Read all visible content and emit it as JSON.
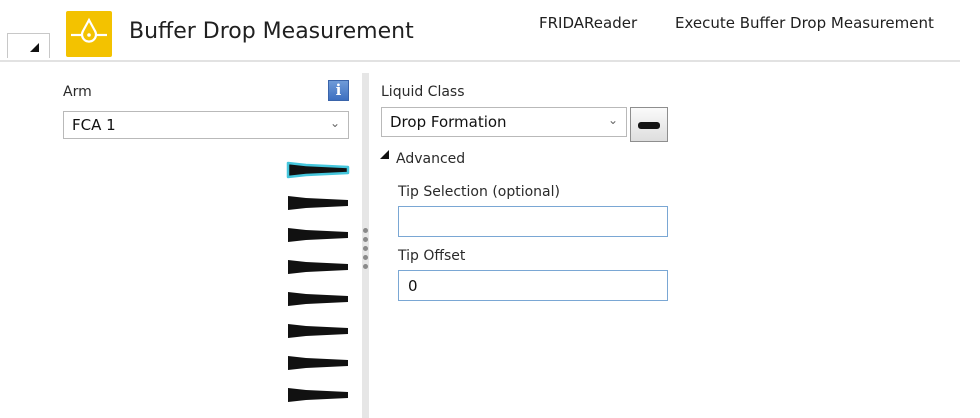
{
  "header": {
    "title": "Buffer Drop Measurement",
    "breadcrumb": [
      "FRIDAReader",
      "Execute Buffer Drop Measurement"
    ],
    "accent_color": "#f3c200",
    "icon": "drop-measurement-icon"
  },
  "left_panel": {
    "arm_label": "Arm",
    "arm_value": "FCA 1",
    "info_icon": "info-icon",
    "info_glyph": "i",
    "tips_count": 8,
    "selected_tip": 1,
    "selected_tip_color": "#45c6dc"
  },
  "right_panel": {
    "liquid_class_label": "Liquid Class",
    "liquid_class_value": "Drop Formation",
    "advanced_label": "Advanced",
    "tip_selection_label": "Tip Selection (optional)",
    "tip_selection_value": "",
    "tip_offset_label": "Tip Offset",
    "tip_offset_value": "0"
  },
  "icons": {
    "chevron": "⌄"
  }
}
